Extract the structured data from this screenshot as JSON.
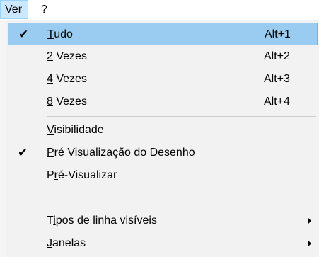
{
  "menubar": {
    "ver": "Ver",
    "help": "?"
  },
  "menu": {
    "items": [
      {
        "pre": "",
        "ul": "T",
        "post": "udo",
        "shortcut": "Alt+1",
        "checked": "✔"
      },
      {
        "pre": "",
        "ul": "2",
        "post": " Vezes",
        "shortcut": "Alt+2",
        "checked": ""
      },
      {
        "pre": "",
        "ul": "4",
        "post": " Vezes",
        "shortcut": "Alt+3",
        "checked": ""
      },
      {
        "pre": "",
        "ul": "8",
        "post": " Vezes",
        "shortcut": "Alt+4",
        "checked": ""
      },
      {
        "pre": "",
        "ul": "V",
        "post": "isibilidade",
        "shortcut": "",
        "checked": ""
      },
      {
        "pre": "",
        "ul": "P",
        "post": "ré Visualização do Desenho",
        "shortcut": "",
        "checked": "✔"
      },
      {
        "pre": "P",
        "ul": "r",
        "post": "é-Visualizar",
        "shortcut": "",
        "checked": ""
      },
      {
        "pre": "T",
        "ul": "i",
        "post": "pos de linha visíveis",
        "shortcut": "",
        "checked": ""
      },
      {
        "pre": "",
        "ul": "J",
        "post": "anelas",
        "shortcut": "",
        "checked": ""
      }
    ]
  }
}
